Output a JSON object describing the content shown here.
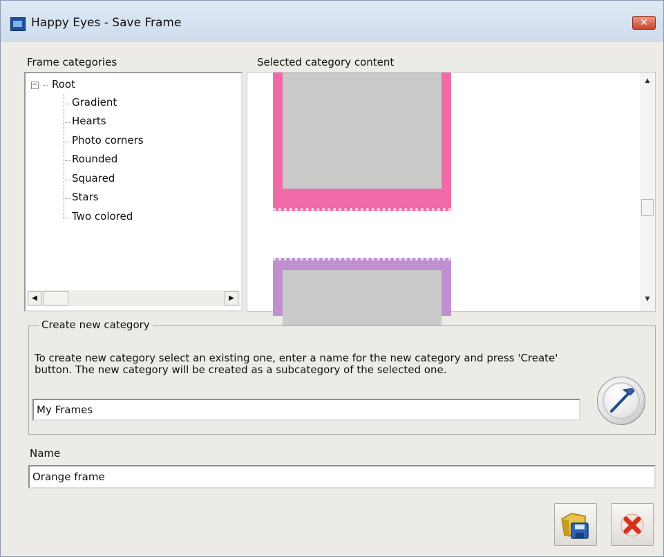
{
  "window": {
    "title": "Happy Eyes - Save Frame",
    "close_glyph": "✕",
    "app_icon": "app-icon"
  },
  "tree": {
    "label": "Frame categories",
    "root": "Root",
    "expander_glyph": "−",
    "items": [
      "Gradient",
      "Hearts",
      "Photo corners",
      "Rounded",
      "Squared",
      "Stars",
      "Two colored"
    ],
    "scroll_left_glyph": "◀",
    "scroll_right_glyph": "▶"
  },
  "content": {
    "label": "Selected category content",
    "scroll_up_glyph": "▲",
    "scroll_down_glyph": "▼",
    "frame_colors": [
      "#ef6aa6",
      "#c08fcf"
    ]
  },
  "create_category": {
    "legend": "Create new category",
    "help": "To create new  category select an existing one, enter a name for the new category and press 'Create' button. The new category will be created as a subcategory of the selected one.",
    "input_value": "My Frames",
    "create_icon": "hammer-icon"
  },
  "name": {
    "label": "Name",
    "input_value": "Orange frame"
  },
  "buttons": {
    "save_icon": "save-icon",
    "cancel_icon": "cancel-icon"
  },
  "colors": {
    "titlebar": "#cfdcec",
    "window_bg": "#ecebe6",
    "close": "#c6472e"
  }
}
